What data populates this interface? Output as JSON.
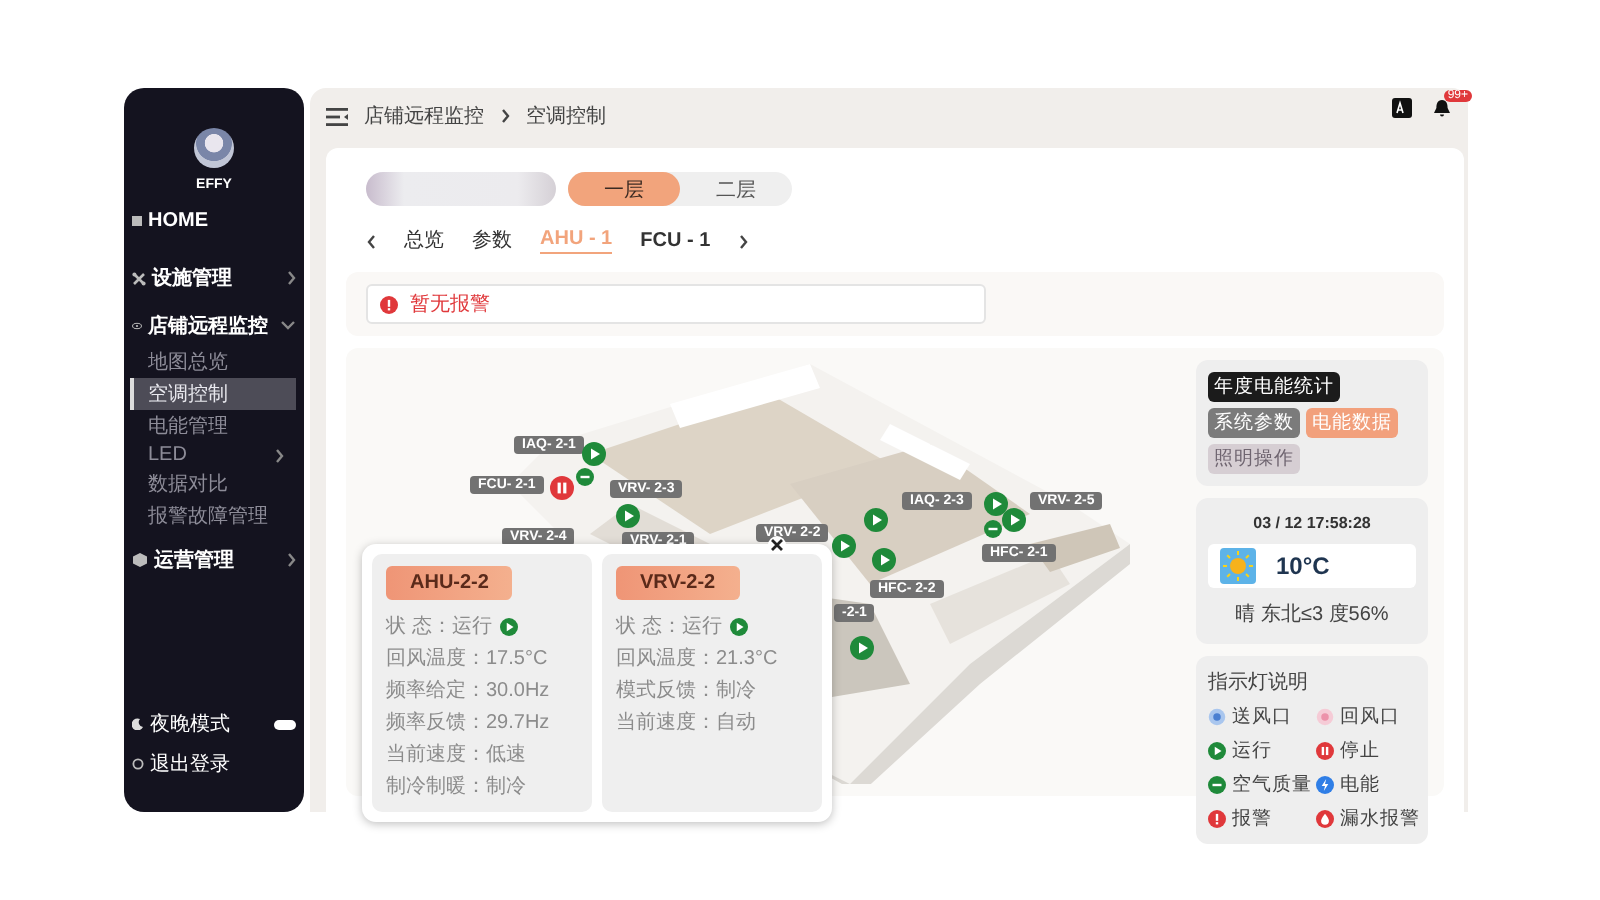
{
  "sidebar": {
    "user": "EFFY",
    "home": "HOME",
    "groups": [
      {
        "label": "设施管理",
        "expanded": false,
        "kind": "tools"
      },
      {
        "label": "店铺远程监控",
        "expanded": true,
        "kind": "eye",
        "children": [
          {
            "label": "地图总览",
            "selected": false,
            "has_submenu": false
          },
          {
            "label": "空调控制",
            "selected": true,
            "has_submenu": false
          },
          {
            "label": "电能管理",
            "selected": false,
            "has_submenu": false
          },
          {
            "label": "LED",
            "selected": false,
            "has_submenu": true
          },
          {
            "label": "数据对比",
            "selected": false,
            "has_submenu": false
          },
          {
            "label": "报警故障管理",
            "selected": false,
            "has_submenu": false
          }
        ]
      },
      {
        "label": "运营管理",
        "expanded": false,
        "kind": "cube"
      }
    ],
    "night_mode": {
      "label": "夜晚模式",
      "on": true
    },
    "logout": "退出登录"
  },
  "breadcrumb": [
    "店铺远程监控",
    "空调控制"
  ],
  "notifications": {
    "badge": "99+"
  },
  "floor_tabs": [
    {
      "label": "一层",
      "selected": true
    },
    {
      "label": "二层",
      "selected": false
    }
  ],
  "device_tabs": [
    {
      "label": "总览",
      "selected": false
    },
    {
      "label": "参数",
      "selected": false
    },
    {
      "label": "AHU - 1",
      "selected": true
    },
    {
      "label": "FCU - 1",
      "selected": false
    }
  ],
  "alarm": "暂无报警",
  "map_labels": [
    "IAQ- 2-1",
    "FCU- 2-1",
    "VRV- 2-3",
    "VRV- 2-4",
    "VRV- 2-1",
    "VRV- 2-2",
    "IAQ- 2-3",
    "VRV- 2-5",
    "HFC- 2-1",
    "HFC- 2-2",
    "-2-1"
  ],
  "map_indicators": [
    {
      "kind": "run"
    },
    {
      "kind": "stop"
    },
    {
      "kind": "air"
    },
    {
      "kind": "run"
    },
    {
      "kind": "run"
    },
    {
      "kind": "run"
    },
    {
      "kind": "run"
    },
    {
      "kind": "run"
    },
    {
      "kind": "run"
    },
    {
      "kind": "air"
    },
    {
      "kind": "run"
    }
  ],
  "popup": {
    "cards": [
      {
        "title": "AHU-2-2",
        "status_text": "状 态：运行",
        "status_icon": {
          "kind": "run"
        },
        "lines": [
          "回风温度：17.5°C",
          "频率给定：30.0Hz",
          "频率反馈：29.7Hz",
          "当前速度：低速",
          "制冷制暖：制冷"
        ]
      },
      {
        "title": "VRV-2-2",
        "status_text": "状 态：运行",
        "status_icon": {
          "kind": "run"
        },
        "lines": [
          "回风温度：21.3°C",
          "模式反馈：制冷",
          "当前速度：自动"
        ]
      }
    ]
  },
  "side_panel": {
    "buttons": [
      {
        "label": "年度电能统计",
        "kind": "dark"
      },
      {
        "label": "系统参数",
        "kind": "grey"
      },
      {
        "label": "电能数据",
        "kind": "accent"
      },
      {
        "label": "照明操作",
        "kind": "muted"
      }
    ],
    "datetime": "03 / 12 17:58:28",
    "temperature": "10°C",
    "weather": "晴 东北≤3 度56%",
    "legend": {
      "title": "指示灯说明",
      "items": [
        {
          "label": "送风口",
          "kind": "supply"
        },
        {
          "label": "回风口",
          "kind": "return"
        },
        {
          "label": "运行",
          "kind": "run"
        },
        {
          "label": "停止",
          "kind": "stop"
        },
        {
          "label": "空气质量",
          "kind": "air"
        },
        {
          "label": "电能",
          "kind": "energy"
        },
        {
          "label": "报警",
          "kind": "alarm"
        },
        {
          "label": "漏水报警",
          "kind": "leak"
        }
      ]
    }
  }
}
